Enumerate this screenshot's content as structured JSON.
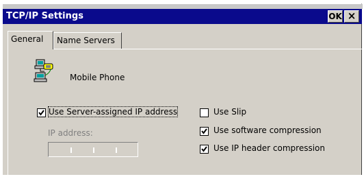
{
  "window": {
    "title": "TCP/IP Settings",
    "ok_label": "OK",
    "close_label": "×"
  },
  "tabs": [
    {
      "label": "General",
      "active": true
    },
    {
      "label": "Name Servers",
      "active": false
    }
  ],
  "connection": {
    "name": "Mobile Phone",
    "icon": "network-computer-phone-icon"
  },
  "options": {
    "server_assigned": {
      "label": "Use Server-assigned IP address",
      "checked": true
    },
    "ip_address_label": "IP address:",
    "ip_octets": [
      "",
      "",
      "",
      ""
    ],
    "use_slip": {
      "label": "Use Slip",
      "checked": false
    },
    "software_compression": {
      "label": "Use software compression",
      "checked": true
    },
    "ip_header_compression": {
      "label": "Use IP header compression",
      "checked": true
    }
  },
  "colors": {
    "titlebar": "#0a0a8c",
    "face": "#d4d0c8",
    "disabled_text": "#808080"
  }
}
